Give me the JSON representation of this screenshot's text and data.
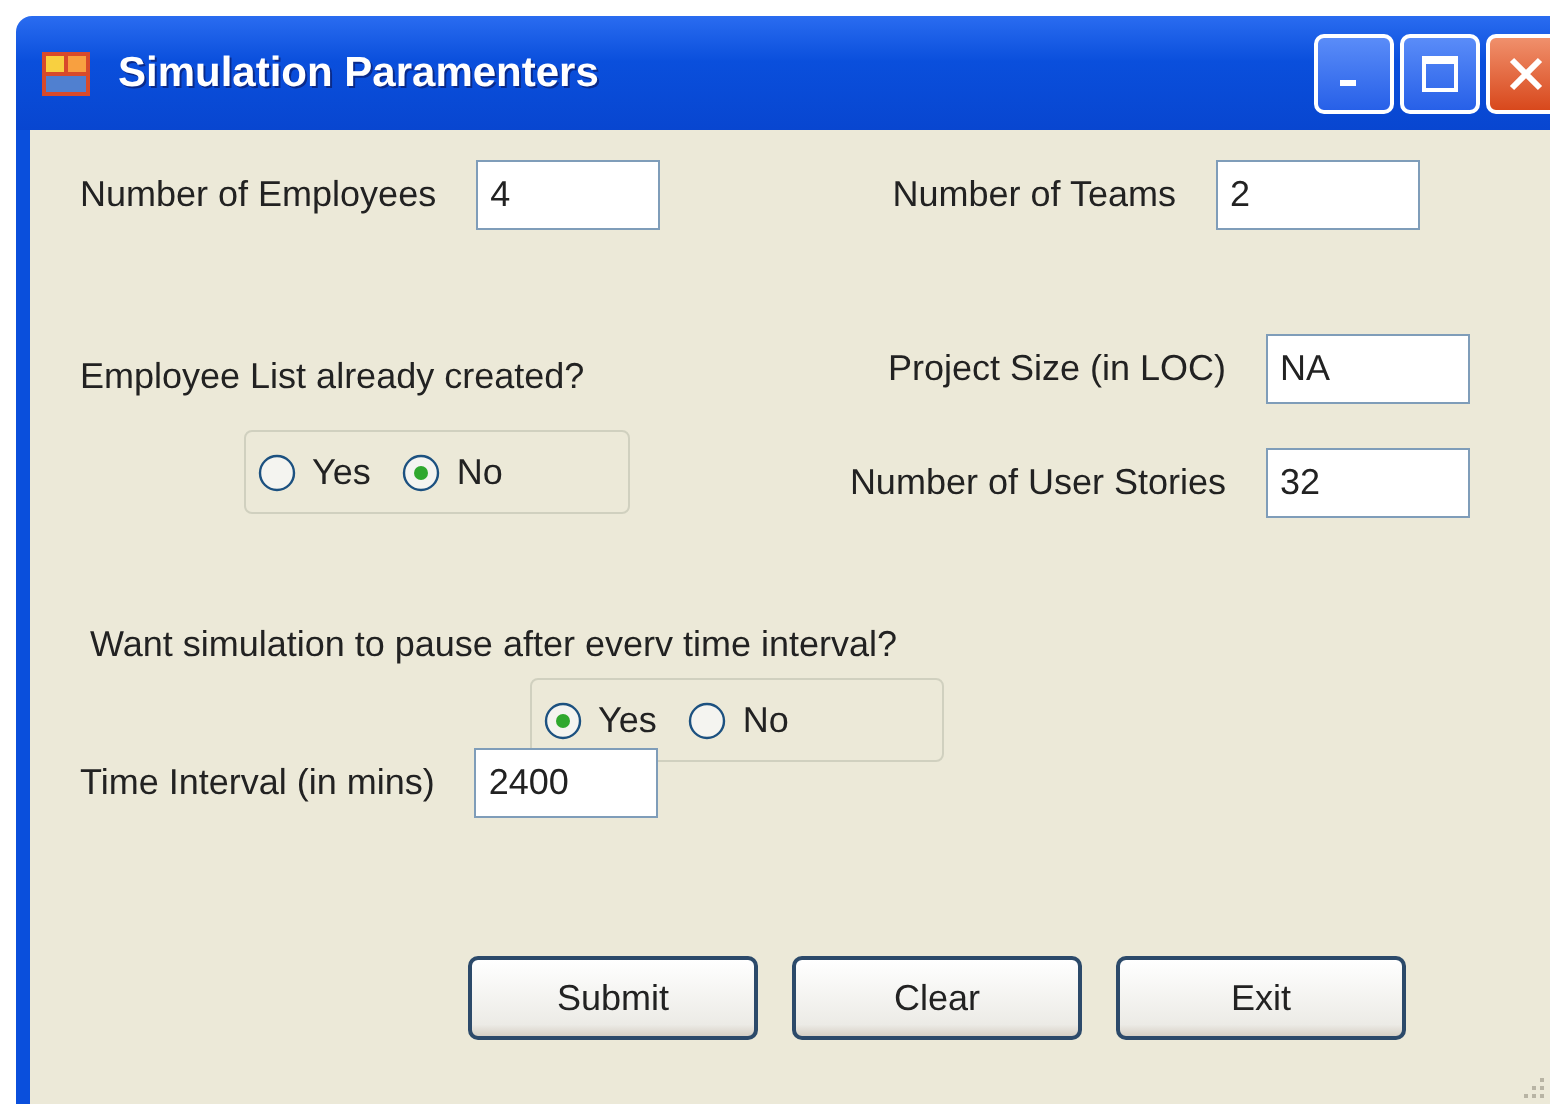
{
  "window": {
    "title": "Simulation Paramenters"
  },
  "employees": {
    "label": "Number of Employees",
    "value": "4"
  },
  "employee_list": {
    "question": "Employee List already created?",
    "options": [
      {
        "label": "Yes",
        "selected": false
      },
      {
        "label": "No",
        "selected": true
      }
    ]
  },
  "teams": {
    "label": "Number of Teams",
    "value": "2"
  },
  "project_size": {
    "label": "Project Size (in LOC)",
    "value": "NA"
  },
  "user_stories": {
    "label": "Number of User Stories",
    "value": "32"
  },
  "pause": {
    "question": "Want simulation to pause after everv time interval?",
    "options": [
      {
        "label": "Yes",
        "selected": true
      },
      {
        "label": "No",
        "selected": false
      }
    ]
  },
  "time_interval": {
    "label": "Time Interval (in mins)",
    "value": "2400"
  },
  "buttons": [
    "Submit",
    "Clear",
    "Exit"
  ]
}
